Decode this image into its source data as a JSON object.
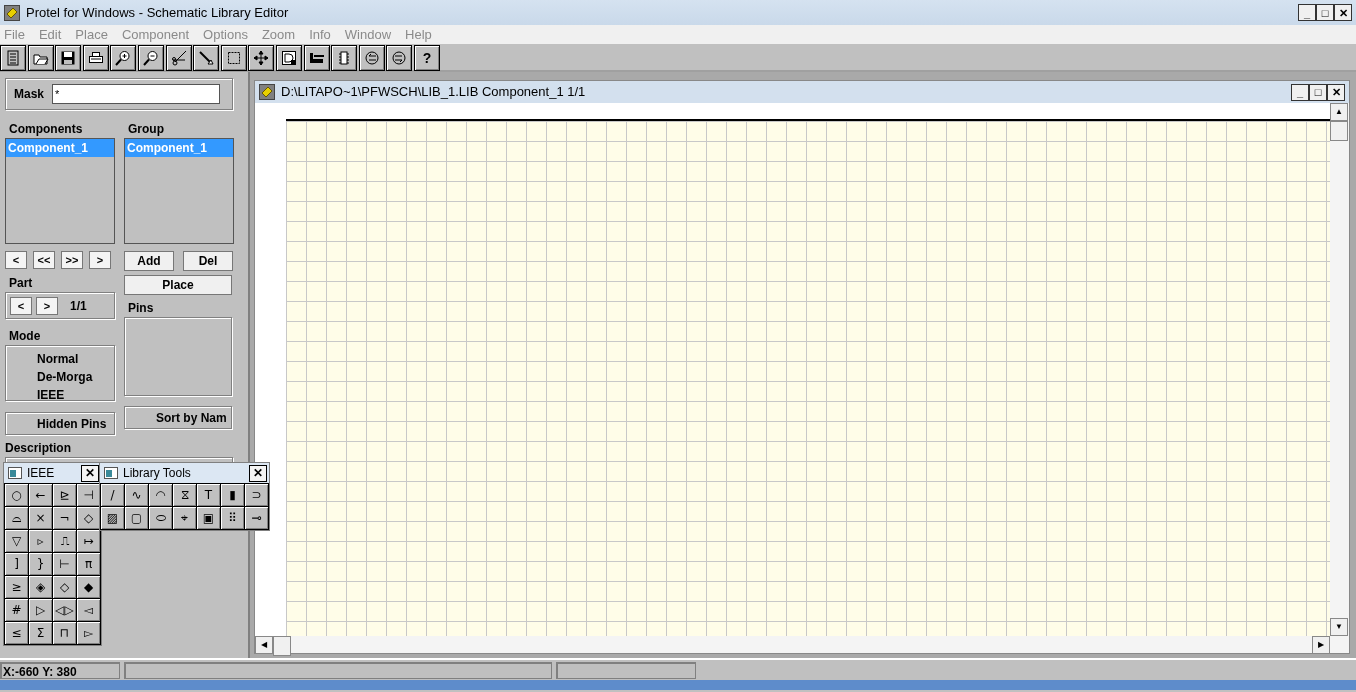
{
  "window": {
    "title": "Protel for Windows - Schematic Library Editor",
    "controls": [
      "_",
      "□",
      "✕"
    ]
  },
  "menu": [
    "File",
    "Edit",
    "Place",
    "Component",
    "Options",
    "Zoom",
    "Info",
    "Window",
    "Help"
  ],
  "toolbar": {
    "help_button": "?"
  },
  "library_panel": {
    "mask": {
      "label": "Mask",
      "value": "*"
    },
    "components": {
      "label": "Components",
      "items": [
        {
          "label": "Component_1",
          "selected": true
        }
      ]
    },
    "group": {
      "label": "Group",
      "items": [
        {
          "label": "Component_1",
          "selected": true
        }
      ]
    },
    "nav_buttons": [
      "<",
      "<<",
      ">>",
      ">"
    ],
    "group_buttons": [
      "Add",
      "Del"
    ],
    "place_button": "Place",
    "part": {
      "label": "Part",
      "buttons": [
        "<",
        ">"
      ],
      "value": "1/1"
    },
    "pins": {
      "label": "Pins"
    },
    "mode": {
      "label": "Mode",
      "options": [
        "Normal",
        "De-Morga",
        "IEEE"
      ]
    },
    "hidden_pins": "Hidden Pins",
    "sort_by_name": "Sort by Nam",
    "description": {
      "label": "Description"
    }
  },
  "palettes": [
    {
      "title": "IEEE",
      "close": "✕",
      "tools": [
        "○",
        "←",
        "⊵",
        "⊣",
        "⌓",
        "×",
        "¬",
        "◇",
        "▽",
        "▹",
        "⎍",
        "↦",
        "]",
        "}",
        "⊢",
        "π",
        "≥",
        "◈",
        "◇",
        "◆",
        "#",
        "▷",
        "◁▷",
        "◅",
        "≤",
        "Σ",
        "⊓",
        "▻"
      ]
    },
    {
      "title": "Library Tools",
      "close": "✕",
      "tools": [
        "/",
        "∿",
        "◠",
        "⧖",
        "T",
        "▮",
        "⊃",
        "▨",
        "▢",
        "⬭",
        "⌖",
        "▣",
        "⠿",
        "⊸"
      ]
    }
  ],
  "document": {
    "title": "D:\\LITAPO~1\\PFWSCH\\LIB_1.LIB  Component_1 1/1",
    "controls": [
      "_",
      "□",
      "✕"
    ],
    "scroll_up": "▲",
    "scroll_down": "▼",
    "scroll_left": "◀",
    "scroll_right": "▶"
  },
  "status_bar": {
    "coordinates": "X:-660 Y: 380"
  }
}
